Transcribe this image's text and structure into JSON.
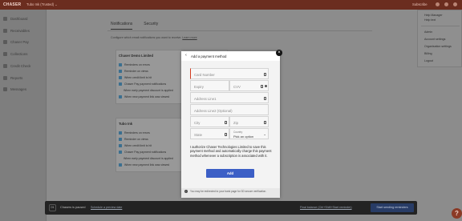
{
  "topbar": {
    "logo": "CHASER",
    "workspace": "Tubo Ink (Trusted) ⌄",
    "subscribe": "Subscribe"
  },
  "sidebar": {
    "items": [
      {
        "label": "Dashboard",
        "icon": "dashboard-icon"
      },
      {
        "label": "Receivables",
        "icon": "receivables-icon"
      },
      {
        "label": "Chaser Pay",
        "icon": "pay-icon"
      },
      {
        "label": "Collections",
        "icon": "collections-icon"
      },
      {
        "label": "Credit Check",
        "icon": "credit-icon"
      },
      {
        "label": "Reports",
        "icon": "reports-icon"
      },
      {
        "label": "Messages",
        "icon": "messages-icon"
      }
    ]
  },
  "main": {
    "tabs": [
      "Notifications",
      "Security"
    ],
    "description": "Configure which email notifications you want to receive.",
    "description_link": "Learn more",
    "panel1": {
      "title": "Chaser Demo Limited",
      "rows": [
        "Reminders on errors",
        "Reminder on views",
        "When credit limit is hit",
        "Chaser Pay payment notifications",
        "When early payment discount is applied",
        "When new payment link was viewed"
      ]
    },
    "panel2": {
      "title": "Tubo Ink",
      "rows": [
        "Reminders on errors",
        "Reminder on views",
        "When credit limit is hit",
        "Chaser Pay payment notifications",
        "When early payment discount is applied",
        "When new payment link was viewed"
      ]
    }
  },
  "dropdown": {
    "items": [
      "Help Manager",
      "Help text",
      "Admin",
      "Account settings",
      "Organisation settings",
      "Billing",
      "Logout"
    ]
  },
  "modal": {
    "back_glyph": "‹",
    "title": "Add a payment method",
    "close_glyph": "×",
    "card_number_placeholder": "Card Number",
    "expiry_placeholder": "Expiry",
    "cvv_placeholder": "CVV",
    "address1_placeholder": "Address Line1",
    "address2_placeholder": "Address Line2 (Optional)",
    "city_placeholder": "City",
    "zip_placeholder": "Zip",
    "state_placeholder": "State",
    "country_label": "Country",
    "country_value": "Pick an option",
    "consent_text": "I authorize Chaser Technologies Limited to save this payment method and automatically charge this payment method whenever a subscription is associated with it.",
    "add_button": "Add",
    "footer_text": "You may be redirected to your bank page for 3D secure verification."
  },
  "bottombar": {
    "badge": "01",
    "status": "Chasers is paused",
    "link1": "Schedule a preview date",
    "link2": "Final balance (Ctrl+Shift+Start reminder)",
    "button": "Start sending reminders"
  },
  "help": {
    "glyph": "?"
  },
  "colors": {
    "accent": "#d23b1f",
    "primary_button": "#3c5fc6",
    "topbar": "#6b2d1f"
  }
}
